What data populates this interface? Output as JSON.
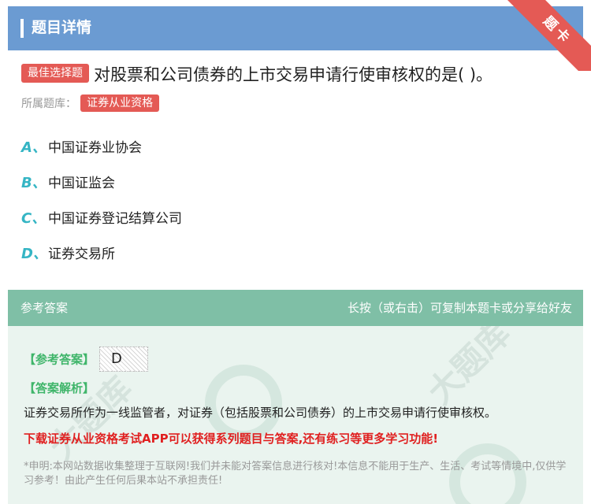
{
  "header": {
    "title": "题目详情",
    "ribbon": "题卡"
  },
  "question": {
    "type_badge": "最佳选择题",
    "text": "对股票和公司债券的上市交易申请行使审核权的是( )。",
    "bank_label": "所属题库：",
    "bank_name": "证券从业资格"
  },
  "options": [
    {
      "letter": "A、",
      "text": "中国证券业协会"
    },
    {
      "letter": "B、",
      "text": "中国证监会"
    },
    {
      "letter": "C、",
      "text": "中国证券登记结算公司"
    },
    {
      "letter": "D、",
      "text": "证券交易所"
    }
  ],
  "answer": {
    "section_title": "参考答案",
    "hint": "长按（或右击）可复制本题卡或分享给好友",
    "answer_label": "【参考答案】",
    "answer_value": "D",
    "analysis_label": "【答案解析】",
    "analysis_text": "证券交易所作为一线监管者，对证券（包括股票和公司债券）的上市交易申请行使审核权。",
    "promo": "下载证券从业资格考试APP可以获得系列题目与答案,还有练习等更多学习功能!",
    "disclaimer": "*申明:本网站数据收集整理于互联网!我们并未能对答案信息进行核对!本信息不能用于生产、生活、考试等情境中,仅供学习参考！由此产生任何后果本站不承担责任!"
  },
  "colors": {
    "header_blue": "#6b9bd2",
    "accent_red": "#e45a55",
    "option_cyan": "#35b5c4",
    "answer_green": "#7fbfa6",
    "label_green": "#3fb56a",
    "promo_red": "#e02020"
  }
}
